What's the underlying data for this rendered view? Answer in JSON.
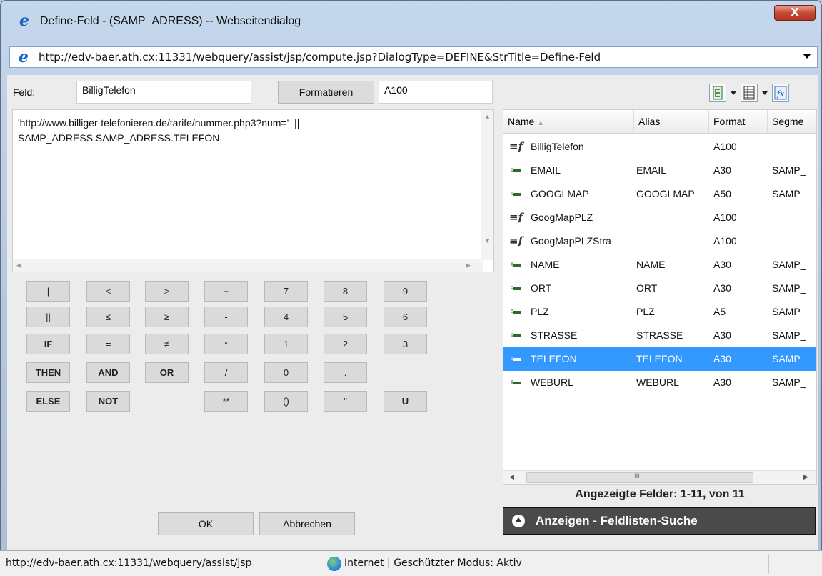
{
  "window": {
    "title": "Define-Feld - (SAMP_ADRESS) -- Webseitendialog",
    "close_label": "X",
    "address": "http://edv-baer.ath.cx:11331/webquery/assist/jsp/compute.jsp?DialogType=DEFINE&StrTitle=Define-Feld"
  },
  "form": {
    "field_label": "Feld:",
    "field_value": "BilligTelefon",
    "format_button": "Formatieren",
    "format_value": "A100"
  },
  "expression": {
    "line1": "'http://www.billiger-telefonieren.de/tarife/nummer.php3?num='  ||",
    "line2": "SAMP_ADRESS.SAMP_ADRESS.TELEFON"
  },
  "calculator": {
    "rows": [
      [
        "|",
        "<",
        ">",
        "+",
        "7",
        "8",
        "9"
      ],
      [
        "||",
        "≤",
        "≥",
        "-",
        "4",
        "5",
        "6"
      ],
      [
        "IF",
        "=",
        "≠",
        "*",
        "1",
        "2",
        "3"
      ],
      [
        "THEN",
        "AND",
        "OR",
        "/",
        "0",
        ".",
        ""
      ],
      [
        "ELSE",
        "NOT",
        "",
        "**",
        "()",
        "\"",
        "U"
      ]
    ]
  },
  "field_list": {
    "columns": [
      "Name",
      "Alias",
      "Format",
      "Segme"
    ],
    "rows": [
      {
        "name": "BilligTelefon",
        "alias": "",
        "format": "A100",
        "segment": "",
        "kind": "computed"
      },
      {
        "name": "EMAIL",
        "alias": "EMAIL",
        "format": "A30",
        "segment": "SAMP_",
        "kind": "field"
      },
      {
        "name": "GOOGLMAP",
        "alias": "GOOGLMAP",
        "format": "A50",
        "segment": "SAMP_",
        "kind": "field"
      },
      {
        "name": "GoogMapPLZ",
        "alias": "",
        "format": "A100",
        "segment": "",
        "kind": "computed"
      },
      {
        "name": "GoogMapPLZStra",
        "alias": "",
        "format": "A100",
        "segment": "",
        "kind": "computed"
      },
      {
        "name": "NAME",
        "alias": "NAME",
        "format": "A30",
        "segment": "SAMP_",
        "kind": "field"
      },
      {
        "name": "ORT",
        "alias": "ORT",
        "format": "A30",
        "segment": "SAMP_",
        "kind": "field"
      },
      {
        "name": "PLZ",
        "alias": "PLZ",
        "format": "A5",
        "segment": "SAMP_",
        "kind": "field"
      },
      {
        "name": "STRASSE",
        "alias": "STRASSE",
        "format": "A30",
        "segment": "SAMP_",
        "kind": "field"
      },
      {
        "name": "TELEFON",
        "alias": "TELEFON",
        "format": "A30",
        "segment": "SAMP_",
        "kind": "field",
        "selected": true
      },
      {
        "name": "WEBURL",
        "alias": "WEBURL",
        "format": "A30",
        "segment": "SAMP_",
        "kind": "field"
      }
    ],
    "scroll_grip": "III",
    "count_text": "Angezeigte Felder: 1-11, von 11",
    "search_toggle": "Anzeigen - Feldlisten-Suche"
  },
  "dialog_buttons": {
    "ok": "OK",
    "cancel": "Abbrechen"
  },
  "status": {
    "url": "http://edv-baer.ath.cx:11331/webquery/assist/jsp",
    "zone": "Internet | Geschützter Modus: Aktiv"
  },
  "colors": {
    "selection": "#3399ff",
    "search_bar": "#4a4a4a"
  }
}
